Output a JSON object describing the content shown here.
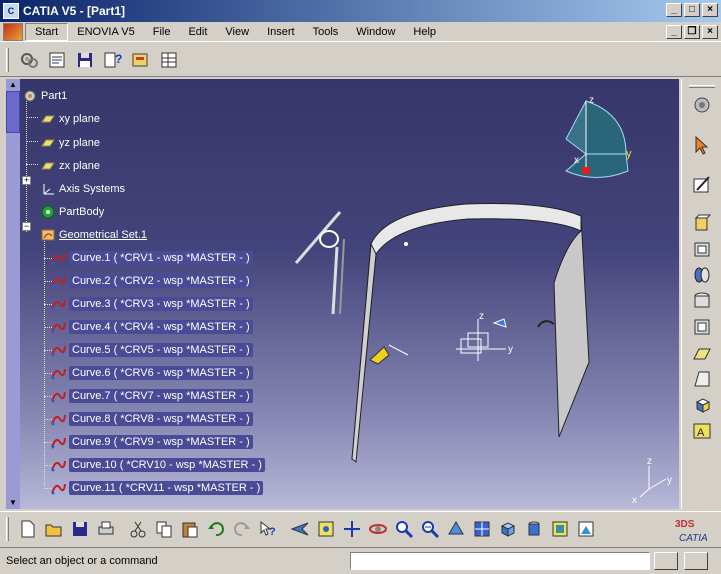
{
  "window": {
    "title": "CATIA V5 - [Part1]"
  },
  "menu": {
    "items": [
      "Start",
      "ENOVIA V5",
      "File",
      "Edit",
      "View",
      "Insert",
      "Tools",
      "Window",
      "Help"
    ]
  },
  "tree": {
    "root": "Part1",
    "planes": [
      "xy plane",
      "yz plane",
      "zx plane"
    ],
    "axis_systems": "Axis Systems",
    "part_body": "PartBody",
    "geometrical_set": "Geometrical Set.1",
    "curves": [
      "Curve.1 ( *CRV1 - wsp *MASTER -  )",
      "Curve.2 ( *CRV2 - wsp *MASTER -  )",
      "Curve.3 ( *CRV3 - wsp *MASTER -  )",
      "Curve.4 ( *CRV4 - wsp *MASTER -  )",
      "Curve.5 ( *CRV5 - wsp *MASTER -  )",
      "Curve.6 ( *CRV6 - wsp *MASTER -  )",
      "Curve.7 ( *CRV7 - wsp *MASTER -  )",
      "Curve.8 ( *CRV8 - wsp *MASTER -  )",
      "Curve.9 ( *CRV9 - wsp *MASTER -  )",
      "Curve.10 ( *CRV10 - wsp *MASTER -  )",
      "Curve.11 ( *CRV11 - wsp *MASTER -  )"
    ]
  },
  "compass": {
    "x": "x",
    "y": "y",
    "z": "z"
  },
  "axis_triad": {
    "x": "x",
    "y": "y",
    "z": "z"
  },
  "status": {
    "message": "Select an object or a command",
    "command_value": ""
  },
  "brand": {
    "logo_text": "CATIA",
    "logo_mark": "3DS"
  },
  "colors": {
    "viewport_top": "#36366a",
    "viewport_bottom": "#b8b8d8",
    "tree_selection": "#4a4a96"
  }
}
